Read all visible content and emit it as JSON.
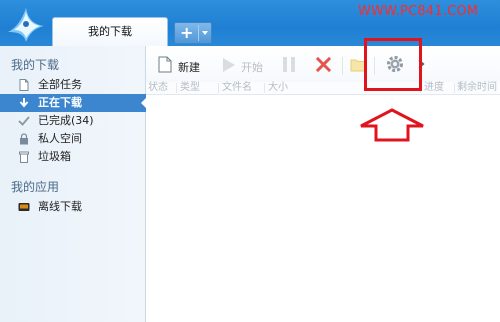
{
  "window": {
    "tab_title": "我的下载",
    "watermark": "WWW.PC841.COM"
  },
  "sidebar": {
    "sections": [
      {
        "title": "我的下载",
        "items": [
          {
            "label": "全部任务",
            "icon": "document-icon"
          },
          {
            "label": "正在下载",
            "icon": "download-arrow-icon",
            "active": true
          },
          {
            "label": "已完成(34)",
            "icon": "checkmark-icon"
          },
          {
            "label": "私人空间",
            "icon": "lock-icon"
          },
          {
            "label": "垃圾箱",
            "icon": "trash-icon"
          }
        ]
      },
      {
        "title": "我的应用",
        "items": [
          {
            "label": "离线下载",
            "icon": "offline-download-icon"
          }
        ]
      }
    ]
  },
  "toolbar": {
    "new_label": "新建",
    "start_label": "开始"
  },
  "columns": [
    "状态",
    "类型",
    "文件名",
    "大小",
    "进度",
    "剩余时间"
  ],
  "annotation": {
    "box_color": "#e0141c",
    "arrow_color": "#e0141c"
  },
  "colors": {
    "titlebar": "#1f7fd2",
    "active_item": "#3b86cf"
  }
}
